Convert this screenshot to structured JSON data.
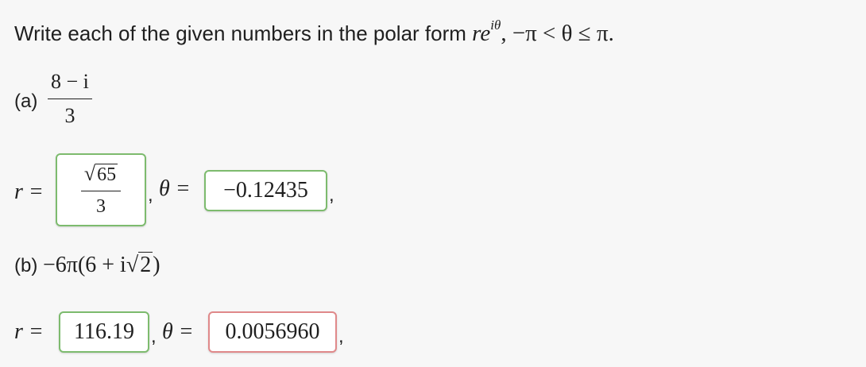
{
  "prompt": {
    "text": "Write each of the given numbers in the polar form ",
    "form_base": "re",
    "form_exp": "iθ",
    "range": ", −π < θ ≤ π."
  },
  "part_a": {
    "label": "(a)",
    "numerator": "8 − i",
    "denominator": "3",
    "r_label": "r =",
    "r_answer": {
      "sqrt_radicand": "65",
      "denominator": "3",
      "status": "correct"
    },
    "comma1": ",",
    "theta_label": "θ =",
    "theta_answer": {
      "value": "−0.12435",
      "status": "correct"
    },
    "comma2": ","
  },
  "part_b": {
    "label": "(b)",
    "expr_before": "−6π(6 + i",
    "expr_radicand": "2",
    "expr_after": ")",
    "r_label": "r =",
    "r_answer": {
      "value": "116.19",
      "status": "correct"
    },
    "comma1": ",",
    "theta_label": "θ =",
    "theta_answer": {
      "value": "0.0056960",
      "status": "incorrect"
    },
    "comma2": ","
  },
  "colors": {
    "correct_border": "#7dbb6e",
    "incorrect_border": "#e0898a",
    "background": "#f7f7f7"
  }
}
